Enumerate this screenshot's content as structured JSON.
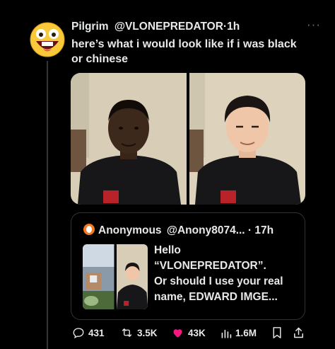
{
  "tweet": {
    "author_name": "Pilgrim",
    "handle": "@VLONEPREDATOR",
    "separator": "·",
    "time": "1h",
    "more": "···",
    "text": "here’s what i would look like if i was black or chinese",
    "avatar_icon": "grinning-face-emoji"
  },
  "quote": {
    "author_name": "Anonymous",
    "handle": "@Anony8074...",
    "separator": "·",
    "time": "17h",
    "text": "Hello\n“VLONEPREDATOR”.\nOr should I use your real\nname, EDWARD IMGE..."
  },
  "actions": {
    "replies": "431",
    "reposts": "3.5K",
    "likes": "43K",
    "views": "1.6M"
  },
  "colors": {
    "background": "#000000",
    "text": "#e7e9ea",
    "muted": "#71767b",
    "like": "#f91880",
    "border": "#2f3336"
  }
}
